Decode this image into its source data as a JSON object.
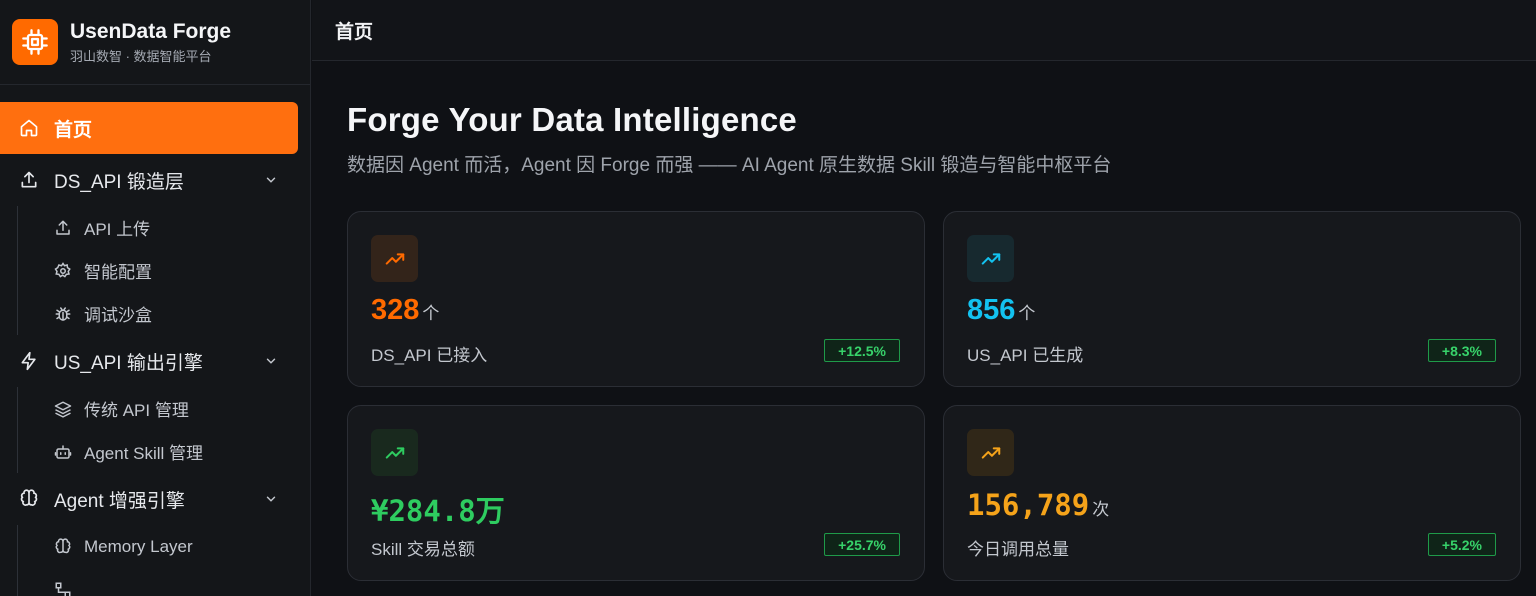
{
  "brand": {
    "name": "UsenData Forge",
    "subtitle": "羽山数智 · 数据智能平台"
  },
  "nav": {
    "home": "首页",
    "ds_group": "DS_API 锻造层",
    "ds_items": [
      "API 上传",
      "智能配置",
      "调试沙盒"
    ],
    "us_group": "US_API 输出引擎",
    "us_items": [
      "传统 API 管理",
      "Agent Skill 管理"
    ],
    "agent_group": "Agent 增强引擎",
    "agent_items": [
      "Memory Layer"
    ]
  },
  "topbar": {
    "title": "首页"
  },
  "hero": {
    "title": "Forge Your Data Intelligence",
    "subtitle": "数据因 Agent 而活，Agent 因 Forge 而强 —— AI Agent 原生数据 Skill 锻造与智能中枢平台"
  },
  "cards": [
    {
      "value": "328",
      "unit": "个",
      "label": "DS_API 已接入",
      "change": "+12.5%",
      "color": "#ff6a00",
      "icon_bg": "#33241a",
      "icon": "trending-up-icon"
    },
    {
      "value": "856",
      "unit": "个",
      "label": "US_API 已生成",
      "change": "+8.3%",
      "color": "#13c2f0",
      "icon_bg": "#17292f",
      "icon": "trending-up-icon"
    },
    {
      "value": "¥284.8万",
      "unit": "",
      "label": "Skill 交易总额",
      "change": "+25.7%",
      "color": "#2ecc60",
      "icon_bg": "#19291e",
      "icon": "trending-up-icon"
    },
    {
      "value": "156,789",
      "unit": "次",
      "label": "今日调用总量",
      "change": "+5.2%",
      "color": "#f5a31a",
      "icon_bg": "#302718",
      "icon": "trending-up-icon"
    }
  ]
}
